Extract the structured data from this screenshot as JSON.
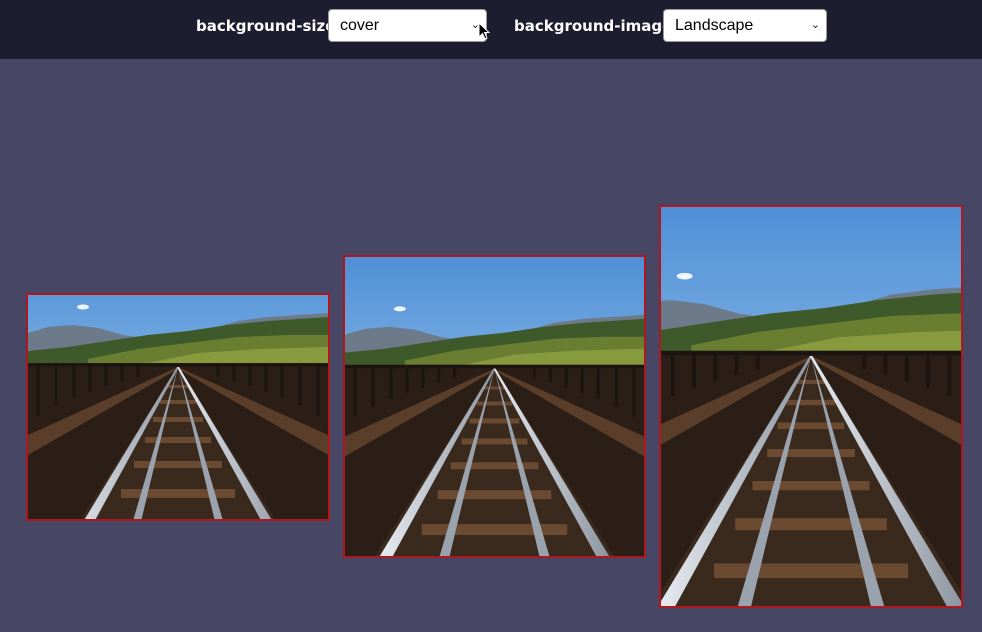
{
  "controls": {
    "size_label": "background-size:",
    "size_value": "cover",
    "image_label": "background-image:",
    "image_value": "Landscape"
  },
  "icons": {
    "cursor": "arrow-cursor-icon",
    "dropdown": "chevron-down-icon"
  },
  "colors": {
    "toolbar": "#1e1d2f",
    "stage": "#484665",
    "frame_border": "#b01820"
  },
  "images": [
    {
      "alt": "railway-bridge-landscape"
    },
    {
      "alt": "railway-bridge-landscape"
    },
    {
      "alt": "railway-bridge-landscape"
    }
  ]
}
